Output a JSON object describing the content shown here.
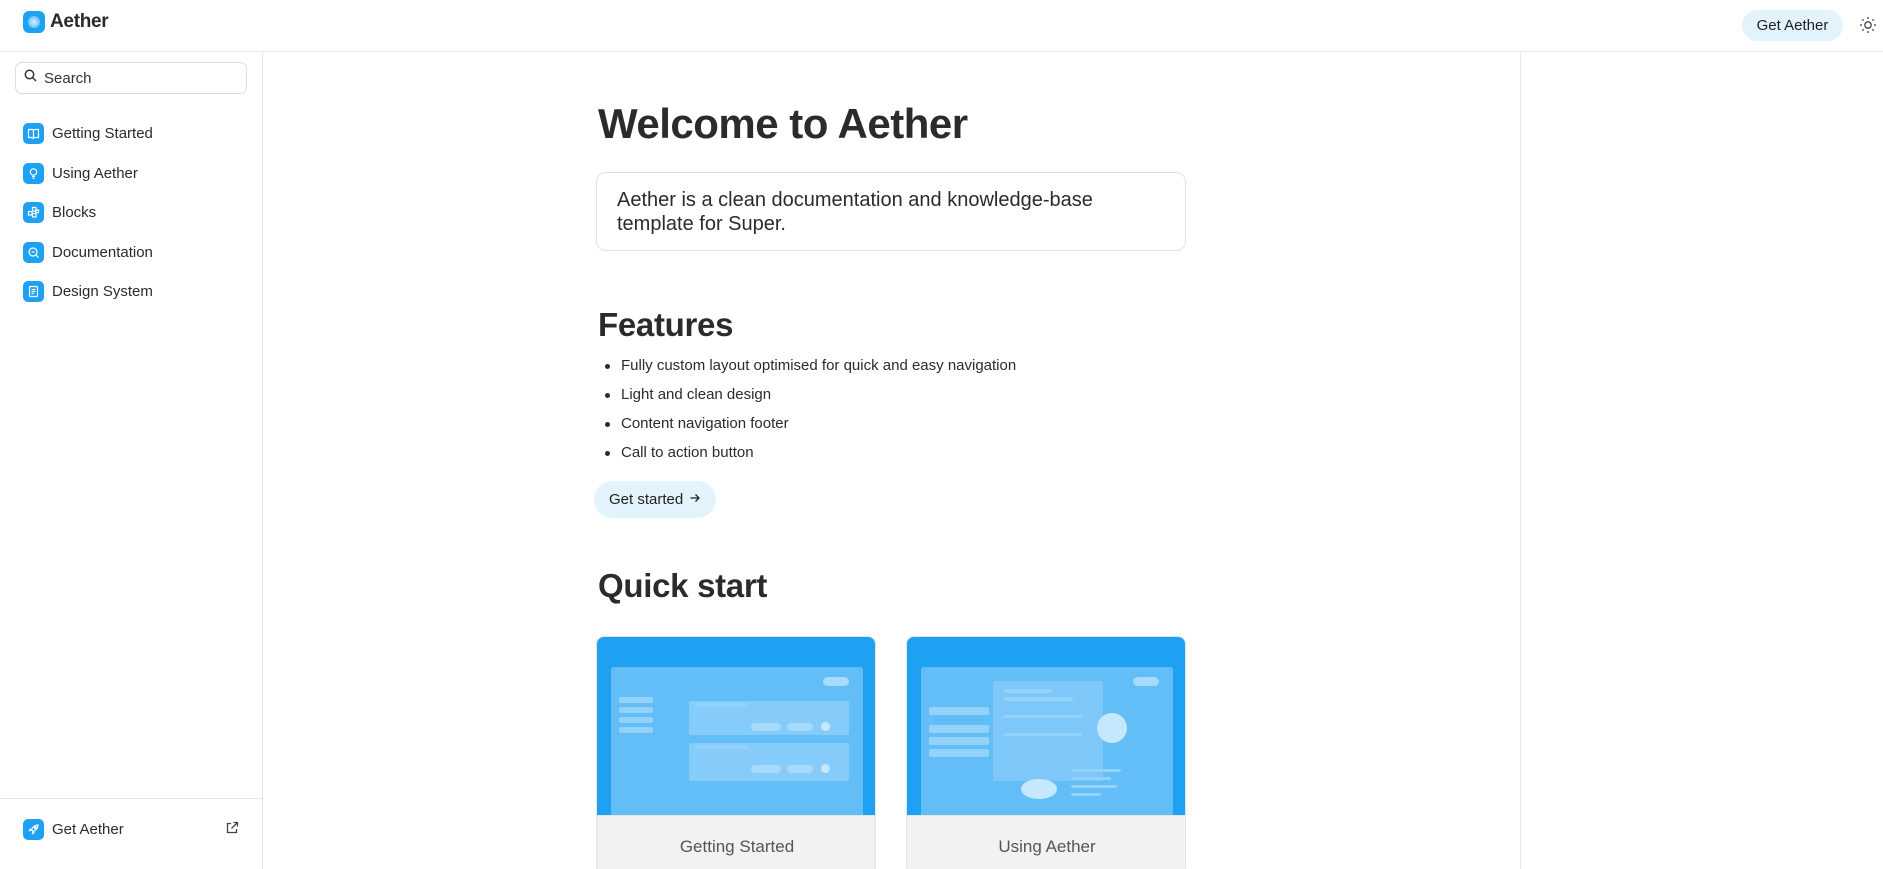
{
  "header": {
    "brand": "Aether",
    "cta_label": "Get Aether",
    "theme_toggle_icon": "sun-icon"
  },
  "sidebar": {
    "search": {
      "placeholder": "Search",
      "icon": "search-icon"
    },
    "items": [
      {
        "label": "Getting Started",
        "icon": "book-icon"
      },
      {
        "label": "Using Aether",
        "icon": "lightbulb-icon"
      },
      {
        "label": "Blocks",
        "icon": "blocks-icon"
      },
      {
        "label": "Documentation",
        "icon": "search-doc-icon"
      },
      {
        "label": "Design System",
        "icon": "document-icon"
      }
    ],
    "footer": {
      "label": "Get Aether",
      "icon": "rocket-icon",
      "external_icon": "external-link-icon"
    }
  },
  "main": {
    "title": "Welcome to Aether",
    "intro": "Aether is a clean documentation and knowledge-base template for Super.",
    "features_title": "Features",
    "features": [
      "Fully custom layout optimised for quick and easy navigation",
      "Light and clean design",
      "Content navigation footer",
      "Call to action button"
    ],
    "cta_label": "Get started",
    "cta_icon": "arrow-right-icon",
    "quickstart_title": "Quick start",
    "cards": [
      {
        "label": "Getting Started"
      },
      {
        "label": "Using Aether"
      }
    ]
  },
  "colors": {
    "accent": "#1ea1f2",
    "accent_light": "#e3f3fd",
    "border": "#e6e6e6",
    "text": "#2b2b2b"
  }
}
